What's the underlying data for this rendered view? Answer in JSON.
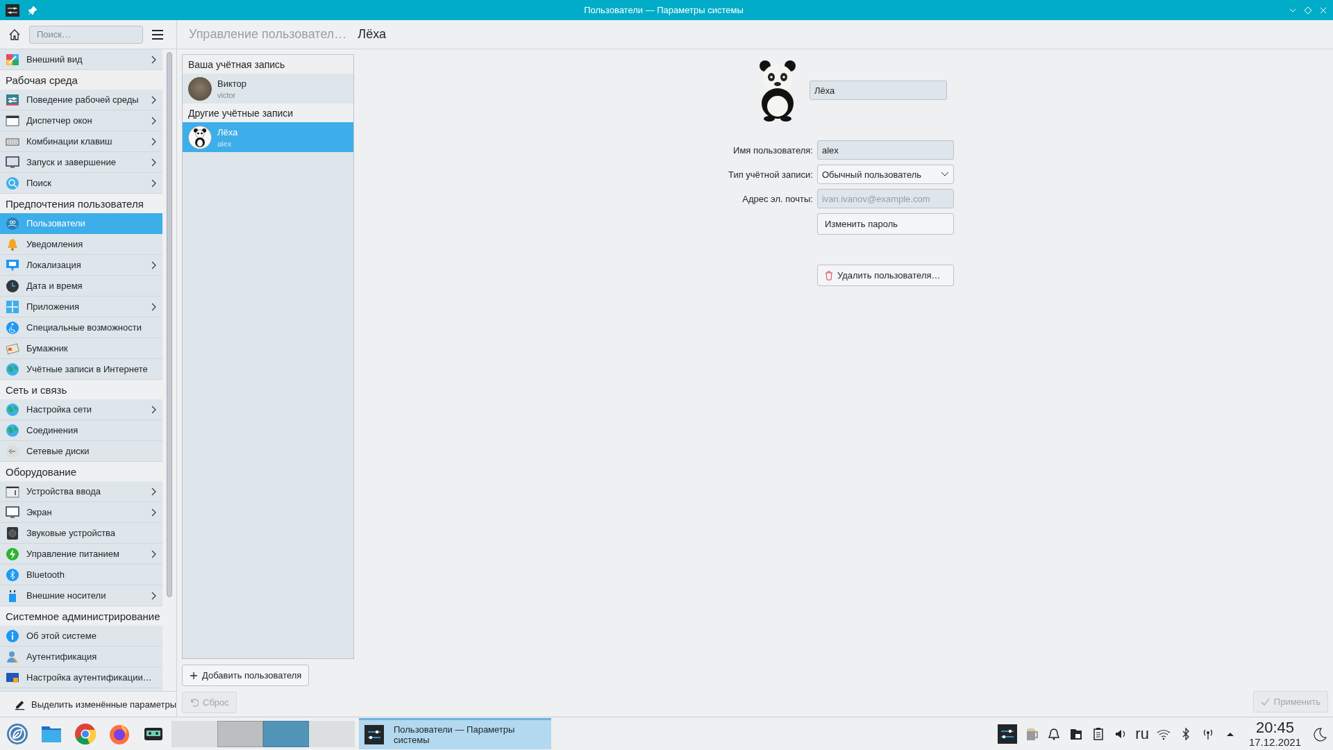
{
  "window": {
    "title": "Пользователи — Параметры системы"
  },
  "toolbar": {
    "search": {
      "placeholder": "Поиск…"
    },
    "breadcrumb": "Управление пользовател…",
    "page_title": "Лёха"
  },
  "sidebar": {
    "groups": [
      {
        "items": [
          {
            "label": "Внешний вид",
            "has_children": true,
            "selected": false
          }
        ]
      },
      {
        "title": "Рабочая среда",
        "items": [
          {
            "label": "Поведение рабочей среды",
            "has_children": true,
            "selected": false
          },
          {
            "label": "Диспетчер окон",
            "has_children": true,
            "selected": false
          },
          {
            "label": "Комбинации клавиш",
            "has_children": true,
            "selected": false
          },
          {
            "label": "Запуск и завершение",
            "has_children": true,
            "selected": false
          },
          {
            "label": "Поиск",
            "has_children": true,
            "selected": false
          }
        ]
      },
      {
        "title": "Предпочтения пользователя",
        "items": [
          {
            "label": "Пользователи",
            "has_children": false,
            "selected": true
          },
          {
            "label": "Уведомления",
            "has_children": false,
            "selected": false
          },
          {
            "label": "Локализация",
            "has_children": true,
            "selected": false
          },
          {
            "label": "Дата и время",
            "has_children": false,
            "selected": false
          },
          {
            "label": "Приложения",
            "has_children": true,
            "selected": false
          },
          {
            "label": "Специальные возможности",
            "has_children": false,
            "selected": false
          },
          {
            "label": "Бумажник",
            "has_children": false,
            "selected": false
          },
          {
            "label": "Учётные записи в Интернете",
            "has_children": false,
            "selected": false
          }
        ]
      },
      {
        "title": "Сеть и связь",
        "items": [
          {
            "label": "Настройка сети",
            "has_children": true,
            "selected": false
          },
          {
            "label": "Соединения",
            "has_children": false,
            "selected": false
          },
          {
            "label": "Сетевые диски",
            "has_children": false,
            "selected": false
          }
        ]
      },
      {
        "title": "Оборудование",
        "items": [
          {
            "label": "Устройства ввода",
            "has_children": true,
            "selected": false
          },
          {
            "label": "Экран",
            "has_children": true,
            "selected": false
          },
          {
            "label": "Звуковые устройства",
            "has_children": false,
            "selected": false
          },
          {
            "label": "Управление питанием",
            "has_children": true,
            "selected": false
          },
          {
            "label": "Bluetooth",
            "has_children": false,
            "selected": false
          },
          {
            "label": "Внешние носители",
            "has_children": true,
            "selected": false
          }
        ]
      },
      {
        "title": "Системное администрирование",
        "items": [
          {
            "label": "Об этой системе",
            "has_children": false,
            "selected": false
          },
          {
            "label": "Аутентификация",
            "has_children": false,
            "selected": false
          },
          {
            "label": "Настройка аутентификации…",
            "has_children": false,
            "selected": false
          }
        ]
      }
    ]
  },
  "sidebar_footer": {
    "label": "Выделить изменённые параметры"
  },
  "users": {
    "sections": [
      {
        "title": "Ваша учётная запись",
        "users": [
          {
            "name": "Виктор",
            "login": "victor",
            "kind": "photo",
            "selected": false
          }
        ]
      },
      {
        "title": "Другие учётные записи",
        "users": [
          {
            "name": "Лёха",
            "login": "alex",
            "kind": "panda",
            "selected": true
          }
        ]
      }
    ]
  },
  "add_button": {
    "label": "Добавить пользователя"
  },
  "reset_button": {
    "label": "Сброс",
    "disabled": true
  },
  "form": {
    "display_name": "Лёха",
    "fields": [
      {
        "label": "Имя пользователя:",
        "kind": "text",
        "value": "alex"
      },
      {
        "label": "Тип учётной записи:",
        "kind": "select",
        "value": "Обычный пользователь"
      },
      {
        "label": "Адрес эл. почты:",
        "kind": "text",
        "placeholder": "ivan.ivanov@example.com"
      }
    ],
    "change_password": "Изменить пароль",
    "delete_user": "Удалить пользователя…"
  },
  "apply_button": {
    "label": "Применить",
    "disabled": true
  },
  "taskbar": {
    "desktops": [
      {
        "selected": false,
        "has_windows": false
      },
      {
        "selected": false,
        "has_windows": true
      },
      {
        "selected": true,
        "has_windows": true
      },
      {
        "selected": false,
        "has_windows": false
      }
    ],
    "task": {
      "title": "Пользователи — Параметры системы",
      "selected": true
    },
    "keyboard_layout": "ru",
    "clock": {
      "time": "20:45",
      "date": "17.12.2021"
    }
  }
}
